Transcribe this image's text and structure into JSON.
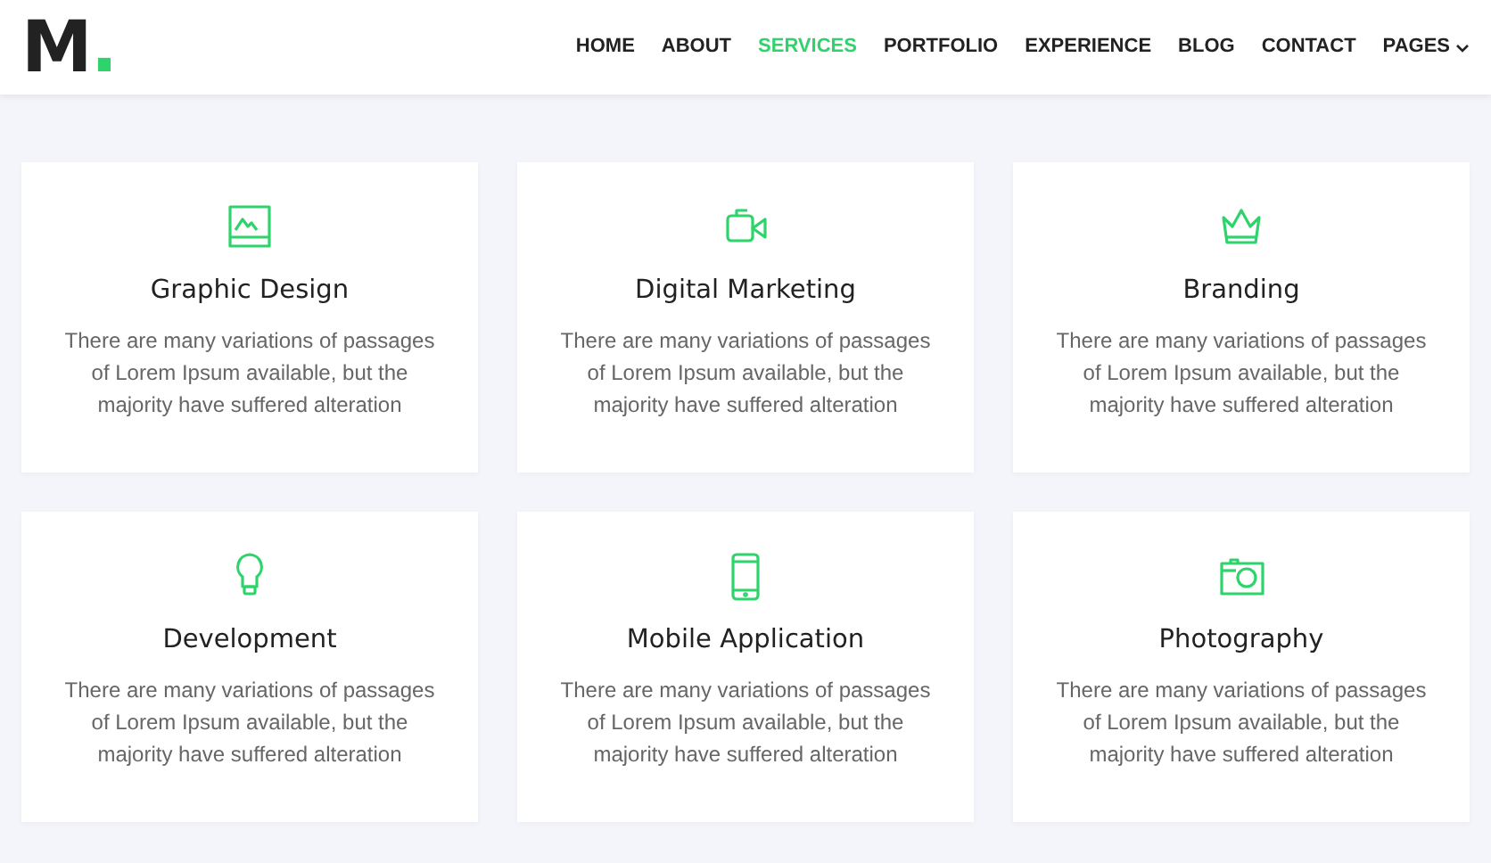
{
  "logo": {
    "text": "M."
  },
  "nav": [
    {
      "label": "HOME",
      "selected": false
    },
    {
      "label": "ABOUT",
      "selected": false
    },
    {
      "label": "SERVICES",
      "selected": true
    },
    {
      "label": "PORTFOLIO",
      "selected": false
    },
    {
      "label": "EXPERIENCE",
      "selected": false
    },
    {
      "label": "BLOG",
      "selected": false
    },
    {
      "label": "CONTACT",
      "selected": false
    },
    {
      "label": "PAGES",
      "selected": false,
      "dropdown": true
    }
  ],
  "services": [
    {
      "title": "Graphic Design",
      "text": "There are many variations of passages of Lorem Ipsum available, but the majority have suffered alteration"
    },
    {
      "title": "Digital Marketing",
      "text": "There are many variations of passages of Lorem Ipsum available, but the majority have suffered alteration"
    },
    {
      "title": "Branding",
      "text": "There are many variations of passages of Lorem Ipsum available, but the majority have suffered alteration"
    },
    {
      "title": "Development",
      "text": "There are many variations of passages of Lorem Ipsum available, but the majority have suffered alteration"
    },
    {
      "title": "Mobile Application",
      "text": "There are many variations of passages of Lorem Ipsum available, but the majority have suffered alteration"
    },
    {
      "title": "Photography",
      "text": "There are many variations of passages of Lorem Ipsum available, but the majority have suffered alteration"
    }
  ]
}
